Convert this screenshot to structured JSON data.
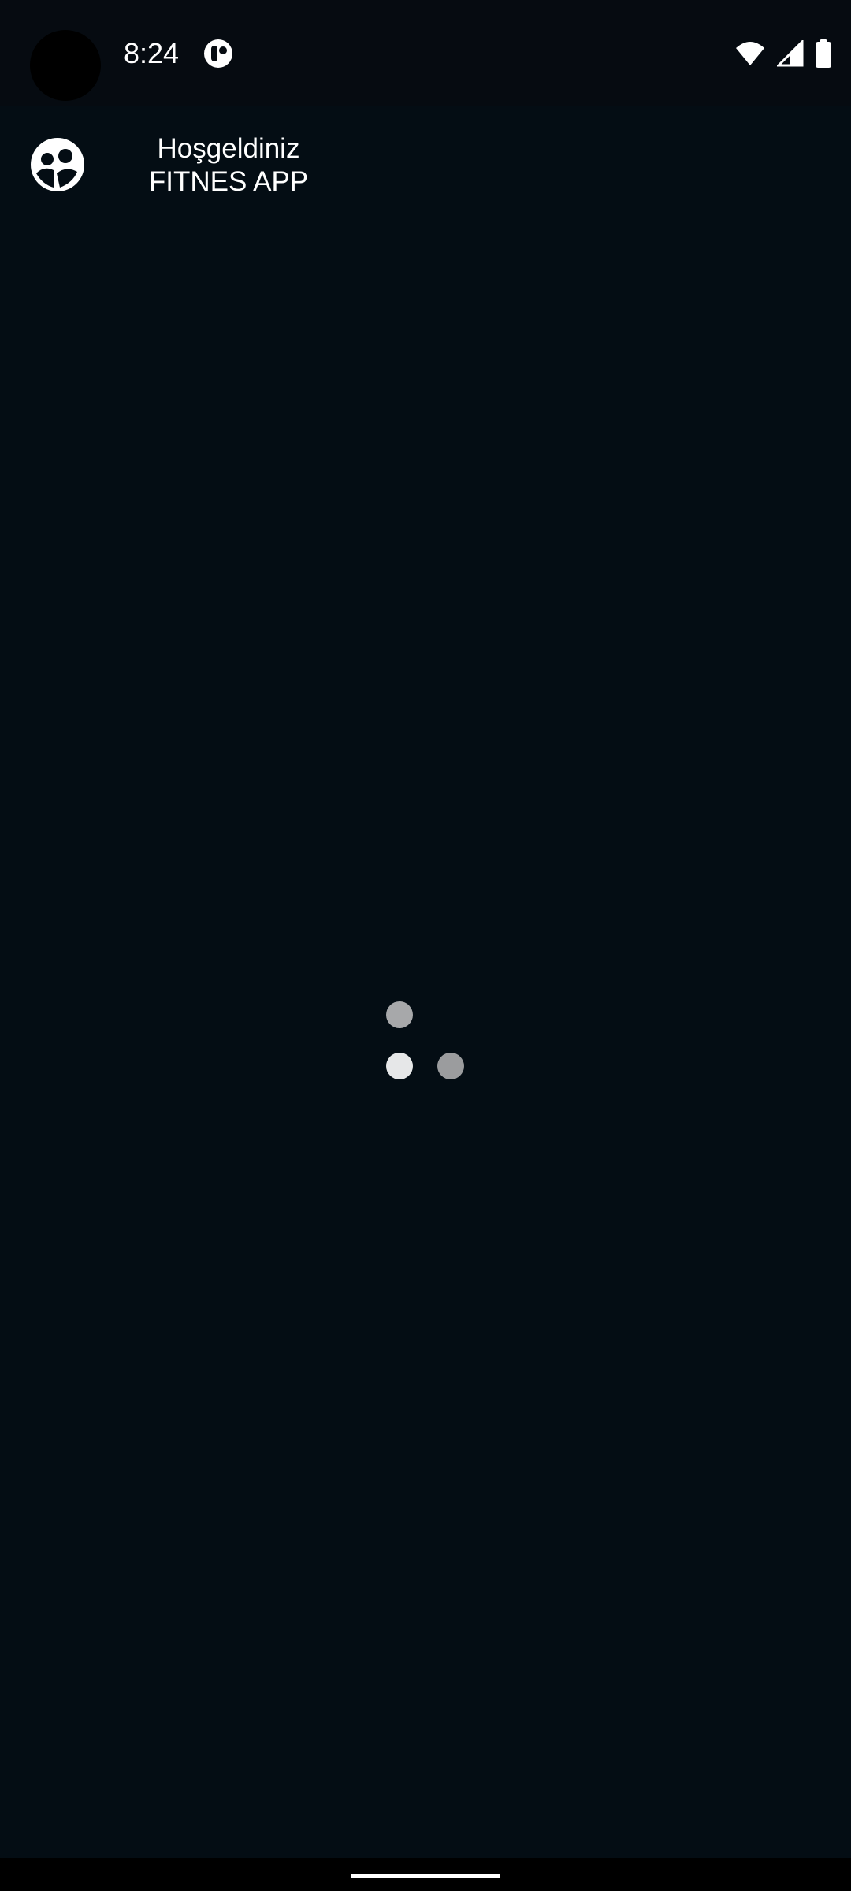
{
  "status_bar": {
    "time": "8:24",
    "icons": [
      "notification-app-icon",
      "wifi-icon",
      "cellular-signal-icon",
      "battery-icon"
    ]
  },
  "header": {
    "avatar_icon": "account-circle-icon",
    "greeting": "Hoşgeldiniz",
    "app_name": "FITNES APP"
  },
  "loader": {
    "icon": "loading-dots-icon",
    "colors": [
      "#a7a8aa",
      "#e6e7e8",
      "#9b9c9e"
    ]
  },
  "colors": {
    "background": "#040d14",
    "status_bar": "#060b11",
    "text": "#ffffff"
  }
}
